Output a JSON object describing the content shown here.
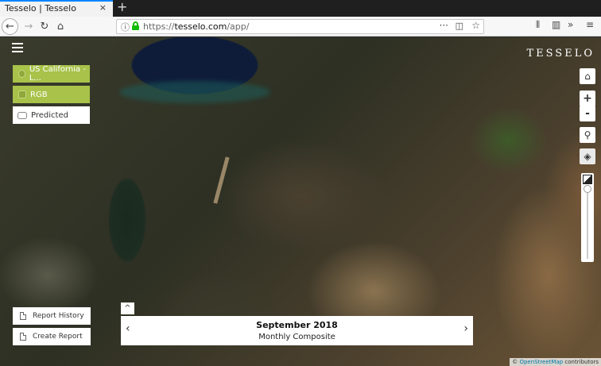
{
  "browser": {
    "tab_title": "Tesselo | Tesselo",
    "tab_close": "×",
    "new_tab": "+",
    "url_prefix": "https://",
    "url_host": "tesselo.com",
    "url_path": "/app/",
    "icons": [
      "back-icon",
      "forward-icon",
      "reload-icon",
      "home-icon",
      "info-icon",
      "lock-icon",
      "page-actions-icon",
      "pocket-icon",
      "bookmark-star-icon",
      "library-icon",
      "sidebar-icon",
      "overflow-icon",
      "menu-icon"
    ]
  },
  "app": {
    "logo": "TESSELO",
    "layers": [
      {
        "label": "US California - L...",
        "style": "green"
      },
      {
        "label": "RGB",
        "style": "green"
      },
      {
        "label": "Predicted",
        "style": "white"
      }
    ],
    "reports": {
      "history_label": "Report History",
      "create_label": "Create Report"
    },
    "time": {
      "month": "September 2018",
      "subtitle": "Monthly Composite",
      "prev": "‹",
      "next": "›",
      "expand": "^"
    },
    "controls": {
      "zoom_in": "+",
      "zoom_out": "-"
    },
    "attribution": {
      "prefix": "© ",
      "link": "OpenStreetMap",
      "suffix": " contributors"
    }
  }
}
